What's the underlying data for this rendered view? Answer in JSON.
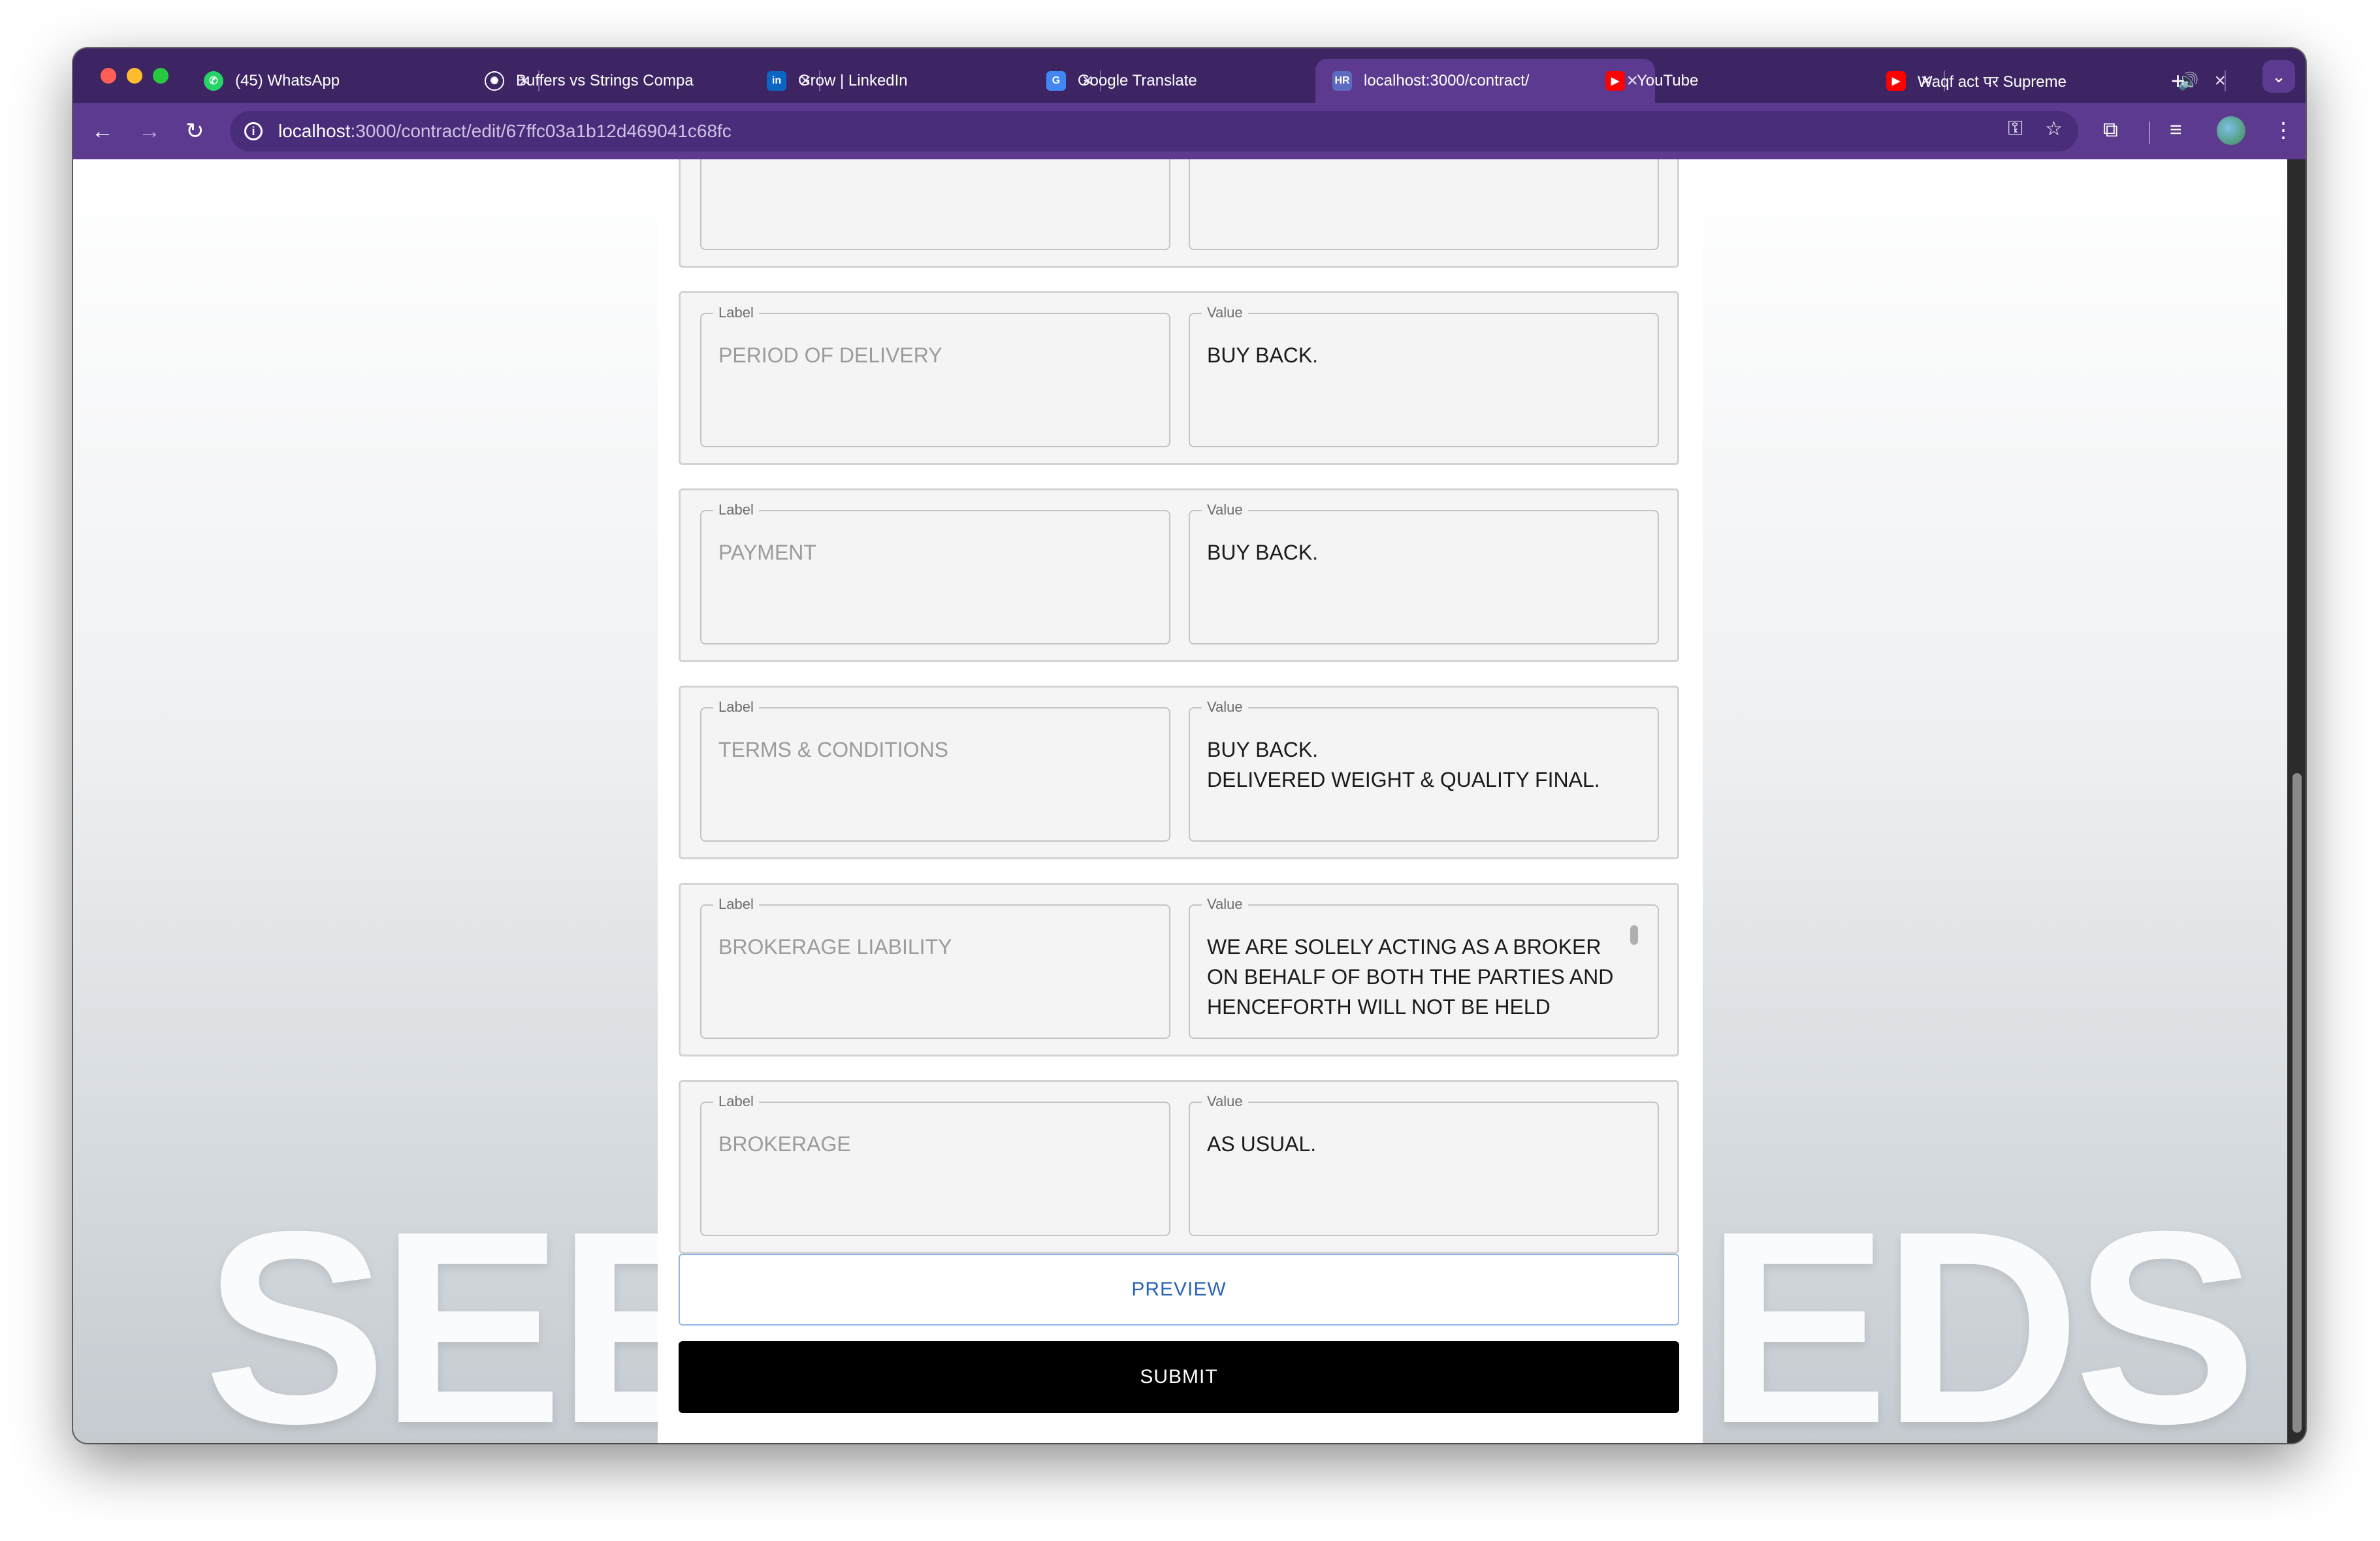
{
  "browser": {
    "tabs": [
      {
        "title": "(45) WhatsApp",
        "icon": "whatsapp-icon"
      },
      {
        "title": "Buffers vs Strings Compa",
        "icon": "chatgpt-icon"
      },
      {
        "title": "Grow | LinkedIn",
        "icon": "linkedin-icon"
      },
      {
        "title": "Google Translate",
        "icon": "google-translate-icon"
      },
      {
        "title": "localhost:3000/contract/",
        "icon": "hr-icon",
        "active": true
      },
      {
        "title": "YouTube",
        "icon": "youtube-icon"
      },
      {
        "title": "Waqf act पर Supreme",
        "icon": "youtube-icon"
      }
    ],
    "active_tab_favicon": "HR",
    "url_host": "localhost",
    "url_path": ":3000/contract/edit/67ffc03a1b12d469041c68fc",
    "close_glyph": "×",
    "new_tab_glyph": "+"
  },
  "form": {
    "label_legend": "Label",
    "value_legend": "Value",
    "rows": [
      {
        "label": "",
        "value": ""
      },
      {
        "label": "PERIOD OF DELIVERY",
        "value": "BUY BACK."
      },
      {
        "label": "PAYMENT",
        "value": "BUY BACK."
      },
      {
        "label": "TERMS & CONDITIONS",
        "value": "BUY BACK.\nDELIVERED WEIGHT & QUALITY FINAL."
      },
      {
        "label": "BROKERAGE LIABILITY",
        "value": "WE ARE SOLELY ACTING AS A BROKER ON BEHALF OF BOTH THE PARTIES AND HENCEFORTH WILL NOT BE HELD"
      },
      {
        "label": "BROKERAGE",
        "value": "AS USUAL."
      }
    ],
    "preview_label": "PREVIEW",
    "submit_label": "SUBMIT"
  },
  "background": {
    "left_text": "SEE",
    "right_text": "EDS"
  },
  "colors": {
    "tabstrip": "#3d2564",
    "toolbar": "#5b3a8f",
    "preview_text": "#2b63b8",
    "submit_bg": "#000000"
  }
}
